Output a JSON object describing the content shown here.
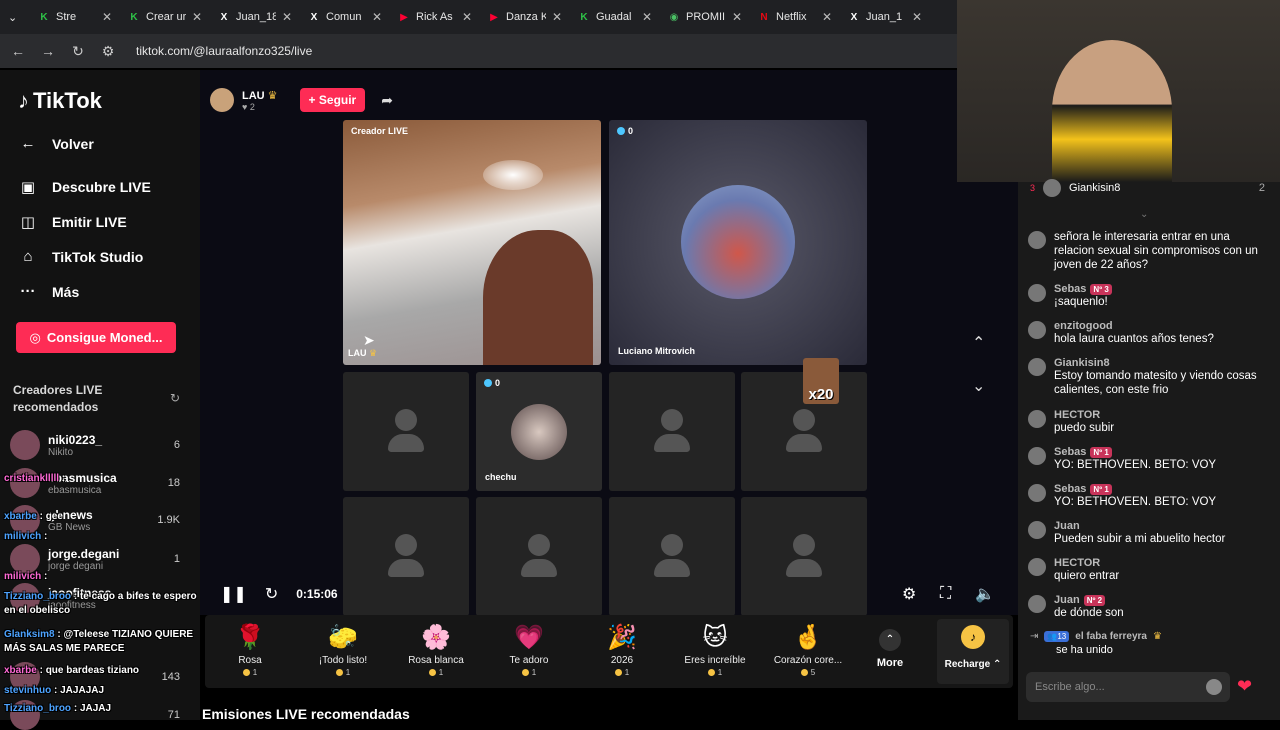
{
  "browser": {
    "tabs": [
      {
        "title": "Stre",
        "icon": "K",
        "color": "#2ec247"
      },
      {
        "title": "Crear ur",
        "icon": "K",
        "color": "#2ec247"
      },
      {
        "title": "Juan_18",
        "icon": "X",
        "color": "#fff"
      },
      {
        "title": "Comun",
        "icon": "X",
        "color": "#fff"
      },
      {
        "title": "Rick As",
        "icon": "▶",
        "color": "#ff0033"
      },
      {
        "title": "Danza K",
        "icon": "▶",
        "color": "#ff0033"
      },
      {
        "title": "Guadal",
        "icon": "K",
        "color": "#2ec247"
      },
      {
        "title": "PROMII",
        "icon": "◉",
        "color": "#4ac164"
      },
      {
        "title": "Netflix",
        "icon": "N",
        "color": "#e50914"
      },
      {
        "title": "Juan_1",
        "icon": "X",
        "color": "#fff"
      }
    ],
    "url": "tiktok.com/@lauraalfonzo325/live"
  },
  "sidebar": {
    "logo": "TikTok",
    "nav": [
      {
        "label": "Volver",
        "icon": "←"
      },
      {
        "label": "Descubre LIVE",
        "icon": "▣"
      },
      {
        "label": "Emitir LIVE",
        "icon": "◫"
      },
      {
        "label": "TikTok Studio",
        "icon": "⌂"
      },
      {
        "label": "Más",
        "icon": "···"
      }
    ],
    "coins_button": "Consigue Moned...",
    "recommended_title": "Creadores LIVE recomendados",
    "creators": [
      {
        "name": "niki0223_",
        "sub": "Nikito",
        "count": "6"
      },
      {
        "name": "ebasmusica",
        "sub": "ebasmusica",
        "count": "18"
      },
      {
        "name": "gbnews",
        "sub": "GB News",
        "count": "1.9K"
      },
      {
        "name": "jorge.degani",
        "sub": "jorge degani",
        "count": "1"
      },
      {
        "name": "jaoofitness",
        "sub": "jaoofitness",
        "count": ""
      },
      {
        "name": "",
        "sub": "",
        "count": "143"
      },
      {
        "name": "",
        "sub": "",
        "count": "71"
      }
    ]
  },
  "overlay_chat": [
    {
      "user": "cristianklllll",
      "msg": ""
    },
    {
      "user": "xbarbe",
      "msg": "gee"
    },
    {
      "user": "milivich",
      "msg": ""
    },
    {
      "user": "milivich",
      "msg": ""
    },
    {
      "user": "Tizziano_broo",
      "msg": "te cago a bifes te espero en el obelisco"
    },
    {
      "user": "Glanksim8",
      "msg": "@Teleese TIZIANO QUIERE MÁS SALAS ME PARECE"
    },
    {
      "user": "xbarbe",
      "msg": "que bardeas tiziano"
    },
    {
      "user": "stevinhuo",
      "msg": "JAJAJAJ"
    },
    {
      "user": "Tizziano_broo",
      "msg": "JAJAJ"
    }
  ],
  "live": {
    "host_name": "LAU",
    "host_likes": "2",
    "follow_label": "+ Seguir",
    "tiles": {
      "main_label_top": "Creador LIVE",
      "main_label_bottom": "LAU",
      "guest1_name": "Luciano Mitrovich",
      "guest1_viewers": "0",
      "guest2_name": "chechu",
      "guest2_viewers": "0",
      "multiplier": "x20"
    },
    "timer": "0:15:06"
  },
  "gifts": [
    {
      "name": "Rosa",
      "price": "1",
      "icon": "🌹"
    },
    {
      "name": "¡Todo listo!",
      "price": "1",
      "icon": "🧽"
    },
    {
      "name": "Rosa blanca",
      "price": "1",
      "icon": "🌸"
    },
    {
      "name": "Te adoro",
      "price": "1",
      "icon": "💗"
    },
    {
      "name": "2026",
      "price": "1",
      "icon": "🎉"
    },
    {
      "name": "Eres increíble",
      "price": "1",
      "icon": "🐱"
    },
    {
      "name": "Corazón core...",
      "price": "5",
      "icon": "🤞"
    }
  ],
  "more_label": "More",
  "recharge_label": "Recharge",
  "recommended_bottom": "Emisiones LIVE recomendadas",
  "chat": {
    "top_user": "Giankisin8",
    "top_count": "2",
    "messages": [
      {
        "user": "",
        "text": "señora le interesaria entrar en una relacion sexual sin compromisos con un joven de 22 años?",
        "badge": ""
      },
      {
        "user": "Sebas",
        "text": "¡saquenlo!",
        "badge": "Nº 3"
      },
      {
        "user": "enzitogood",
        "text": "hola laura cuantos años tenes?",
        "badge": ""
      },
      {
        "user": "Giankisin8",
        "text": "Estoy tomando matesito y viendo cosas calientes, con este frio",
        "badge": ""
      },
      {
        "user": "HECTOR",
        "text": "puedo subir",
        "badge": ""
      },
      {
        "user": "Sebas",
        "text": "YO: BETHOVEEN. BETO: VOY",
        "badge": "Nº 1"
      },
      {
        "user": "Sebas",
        "text": "YO: BETHOVEEN. BETO: VOY",
        "badge": "Nº 1"
      },
      {
        "user": "Juan",
        "text": "Pueden subir a mi abuelito hector",
        "badge": ""
      },
      {
        "user": "HECTOR",
        "text": "quiero entrar",
        "badge": ""
      },
      {
        "user": "Juan",
        "text": "de dónde son",
        "badge": "Nº 2"
      }
    ],
    "joined_user": "el faba ferreyra",
    "joined_text": "se ha unido",
    "joined_level": "13",
    "input_placeholder": "Escribe algo..."
  }
}
